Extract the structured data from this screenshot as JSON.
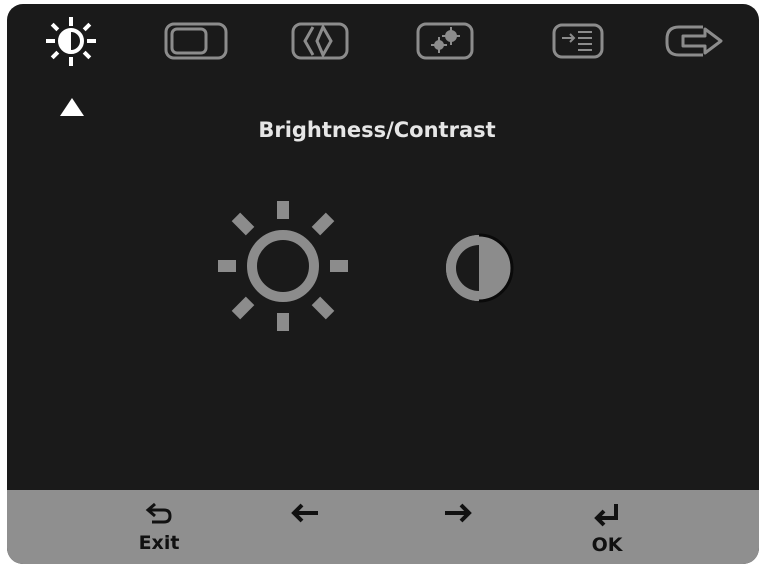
{
  "menu": {
    "items": [
      {
        "icon": "brightness-contrast-icon",
        "selected": true
      },
      {
        "icon": "image-position-icon",
        "selected": false
      },
      {
        "icon": "image-setup-icon",
        "selected": false
      },
      {
        "icon": "image-properties-icon",
        "selected": false
      },
      {
        "icon": "options-icon",
        "selected": false
      },
      {
        "icon": "exit-menu-icon",
        "selected": false
      }
    ]
  },
  "section": {
    "title": "Brightness/Contrast",
    "controls": [
      {
        "icon": "brightness-icon"
      },
      {
        "icon": "contrast-icon"
      }
    ]
  },
  "navigation": {
    "exit_label": "Exit",
    "left_icon": "left-arrow-icon",
    "right_icon": "right-arrow-icon",
    "ok_label": "OK"
  },
  "colors": {
    "background": "#1a1a1a",
    "icon_gray": "#8c8c8c",
    "selected_icon": "#ffffff",
    "nav_bar": "#8f8f8f"
  }
}
